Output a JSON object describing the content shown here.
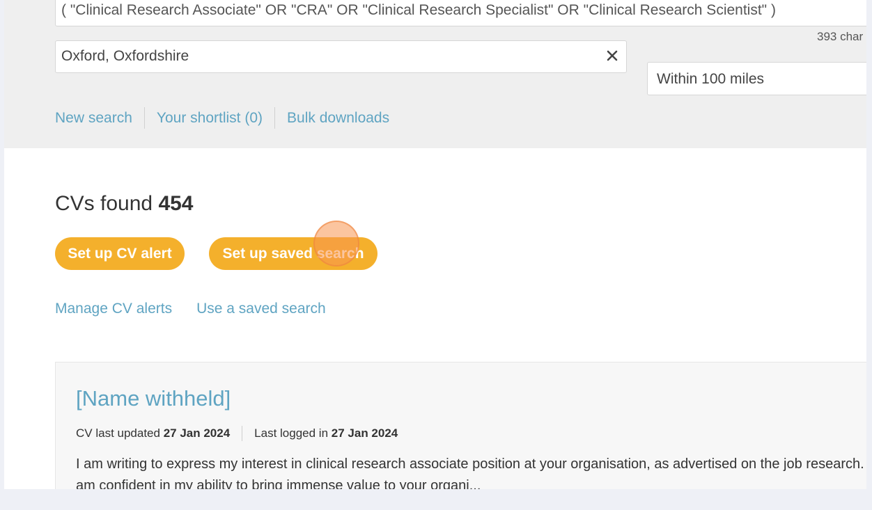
{
  "search": {
    "keywords_value": "( \"Clinical Research Associate\" OR \"CRA\" OR \"Clinical Research Specialist\" OR \"Clinical Research Scientist\" )",
    "char_count": "393 char",
    "location_value": "Oxford, Oxfordshire",
    "radius_value": "Within 100 miles"
  },
  "search_links": {
    "new_search": "New search",
    "shortlist": "Your shortlist (0)",
    "bulk_downloads": "Bulk downloads"
  },
  "results": {
    "label": "CVs found",
    "count": "454"
  },
  "buttons": {
    "cv_alert": "Set up CV alert",
    "saved_search": "Set up saved search"
  },
  "alert_links": {
    "manage": "Manage CV alerts",
    "use_saved": "Use a saved search"
  },
  "result_card": {
    "name": "[Name withheld]",
    "cv_updated_label": "CV last updated",
    "cv_updated_date": "27 Jan 2024",
    "logged_in_label": "Last logged in",
    "logged_in_date": "27 Jan 2024",
    "summary": "I am writing to express my interest in clinical research associate position at your organisation, as advertised on the job research. I am confident in my ability to bring immense value to your organi..."
  },
  "icons": {
    "clear": "close-icon"
  },
  "colors": {
    "link": "#5fa4c2",
    "button": "#f4b02c",
    "panel_bg": "#efefef"
  }
}
